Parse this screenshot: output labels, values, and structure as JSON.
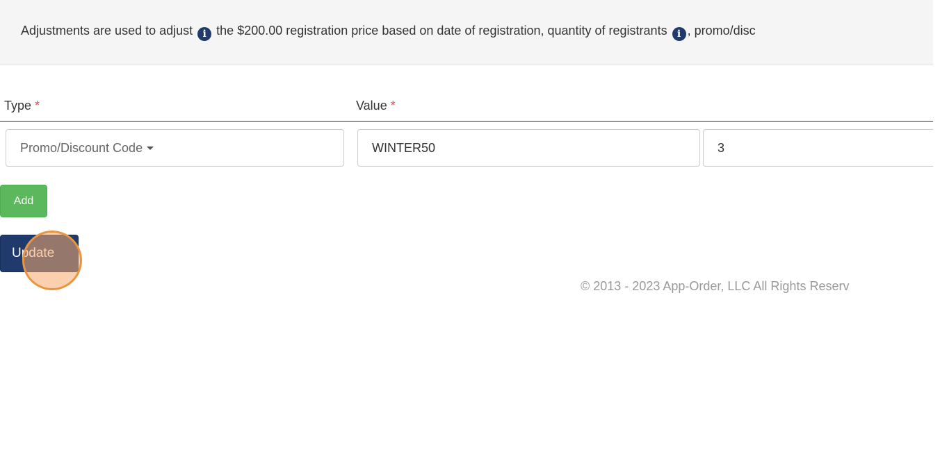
{
  "info": {
    "text_part1": "Adjustments are used to adjust",
    "text_part2": "the $200.00 registration price based on date of registration, quantity of registrants",
    "text_part3": ", promo/disc",
    "icon": "info-circle-icon"
  },
  "form": {
    "type_label": "Type",
    "value_label": "Value",
    "required_marker": "*",
    "type_selected": "Promo/Discount Code",
    "value_code": "WINTER50",
    "value_amount": "3"
  },
  "buttons": {
    "add_label": "Add",
    "update_label": "Update"
  },
  "footer": {
    "copyright": "© 2013 - 2023 App-Order, LLC All Rights Reserv"
  },
  "colors": {
    "primary": "#1f3a6b",
    "success": "#5cb85c",
    "required": "#d9534f",
    "click_marker": "#e8963f"
  }
}
